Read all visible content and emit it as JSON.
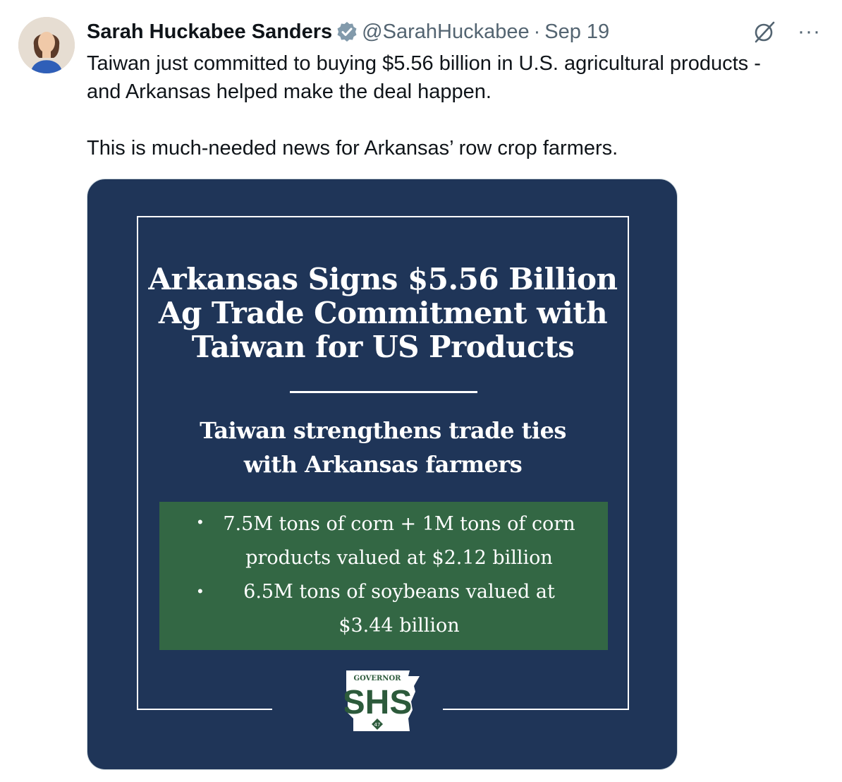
{
  "tweet": {
    "author_name": "Sarah Huckabee Sanders",
    "handle": "@SarahHuckabee",
    "separator": "·",
    "date": "Sep 19",
    "more_label": "···",
    "text_line1": "Taiwan just committed to buying $5.56 billion in U.S. agricultural products -",
    "text_line2": "and Arkansas helped make the deal happen.",
    "text_line3": "This is much-needed news for Arkansas’ row crop farmers."
  },
  "image": {
    "headline_lines": [
      "Arkansas Signs $5.56 Billion",
      "Ag Trade Commitment with",
      "Taiwan for US Products"
    ],
    "subheadline_lines": [
      "Taiwan strengthens trade ties",
      "with Arkansas farmers"
    ],
    "bullet_symbol": "•",
    "bullets": [
      {
        "line1": "7.5M tons of corn + 1M tons of corn",
        "line2": "products valued at $2.12 billion"
      },
      {
        "line1": "6.5M tons of soybeans valued at",
        "line2": "$3.44 billion"
      }
    ],
    "logo": {
      "top_text": "GOVERNOR",
      "main_text": "SHS",
      "badge_text": "47"
    }
  },
  "colors": {
    "navy": "#1f3558",
    "green": "#336744",
    "verified": "#829aab",
    "secondary_text": "#536471"
  }
}
